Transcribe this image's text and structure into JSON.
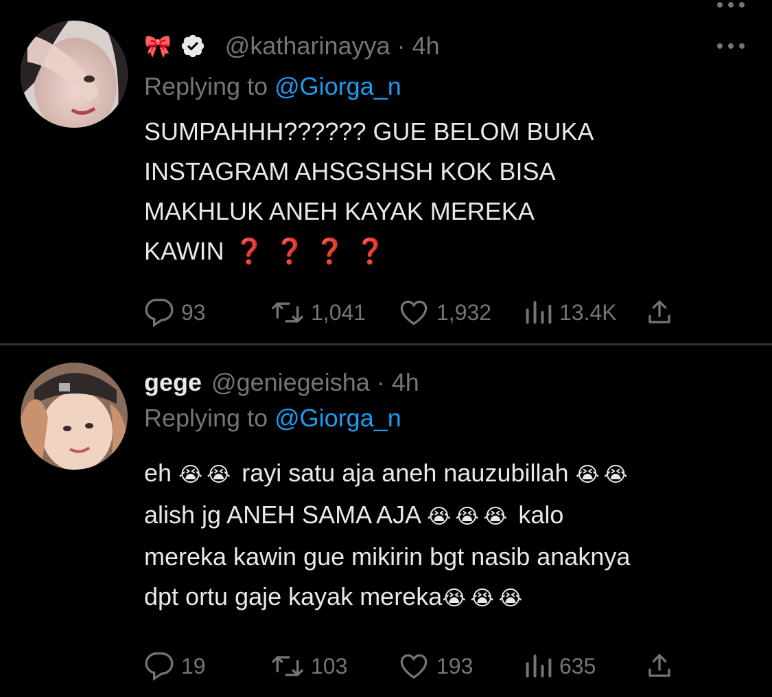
{
  "tweets": [
    {
      "display_name_emoji": "🎀",
      "verified": true,
      "handle": "@katharinayya",
      "separator": "·",
      "time": "4h",
      "replying_prefix": "Replying to",
      "replying_to": "@Giorga_n",
      "body_lines": [
        "SUMPAHHH?????? GUE BELOM BUKA",
        "INSTAGRAM AHSGSHSH KOK BISA",
        "MAKHLUK ANEH KAYAK MEREKA",
        "KAWIN"
      ],
      "trailing_marks": [
        "❓",
        "❓",
        "❓",
        "❓"
      ],
      "stats": {
        "replies": "93",
        "retweets": "1,041",
        "likes": "1,932",
        "views": "13.4K"
      }
    },
    {
      "display_name": "gege",
      "handle": "@geniegeisha",
      "separator": "·",
      "time": "4h",
      "replying_prefix": "Replying to",
      "replying_to": "@Giorga_n",
      "body": {
        "line1_a": "eh",
        "line1_b": "rayi satu aja aneh nauzubillah",
        "line2_a": "alish jg ANEH SAMA AJA",
        "line2_b": "kalo",
        "line3": "mereka kawin gue mikirin bgt nasib anaknya",
        "line4": "dpt ortu gaje kayak mereka"
      },
      "emoji": "😭",
      "stats": {
        "replies": "19",
        "retweets": "103",
        "likes": "193",
        "views": "635"
      }
    }
  ],
  "colors": {
    "background": "#000000",
    "text": "#e7e9ea",
    "secondary": "#71767b",
    "link": "#1d9bf0",
    "divider": "#2f3336",
    "question_mark": "#e0245e"
  },
  "icons": [
    "more-icon",
    "reply-icon",
    "retweet-icon",
    "like-icon",
    "views-icon",
    "share-icon",
    "verified-badge-icon"
  ]
}
